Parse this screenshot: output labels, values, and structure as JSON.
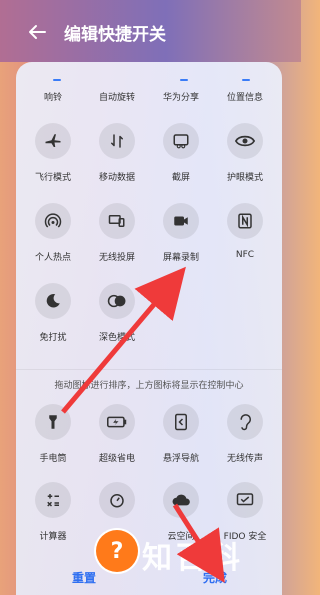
{
  "header": {
    "title": "编辑快捷开关"
  },
  "top_row": [
    "响铃",
    "自动旋转",
    "华为分享",
    "位置信息"
  ],
  "active_tiles": [
    {
      "label": "飞行模式",
      "icon": "airplane-icon"
    },
    {
      "label": "移动数据",
      "icon": "mobile-data-icon"
    },
    {
      "label": "截屏",
      "icon": "screenshot-icon"
    },
    {
      "label": "护眼模式",
      "icon": "eye-icon"
    },
    {
      "label": "个人热点",
      "icon": "hotspot-icon"
    },
    {
      "label": "无线投屏",
      "icon": "wireless-projection-icon"
    },
    {
      "label": "屏幕录制",
      "icon": "screen-record-icon"
    },
    {
      "label": "NFC",
      "icon": "nfc-icon"
    },
    {
      "label": "免打扰",
      "icon": "moon-icon"
    },
    {
      "label": "深色模式",
      "icon": "dark-mode-icon"
    }
  ],
  "hint": "拖动图标进行排序，上方图标将显示在控制中心",
  "inactive_tiles": [
    {
      "label": "手电筒",
      "icon": "flashlight-icon"
    },
    {
      "label": "超级省电",
      "icon": "battery-saver-icon"
    },
    {
      "label": "悬浮导航",
      "icon": "floating-nav-icon"
    },
    {
      "label": "无线传声",
      "icon": "hearing-icon"
    },
    {
      "label": "计算器",
      "icon": "calculator-icon"
    },
    {
      "label": "计时器",
      "icon": "timer-icon"
    },
    {
      "label": "云空间",
      "icon": "cloud-icon"
    },
    {
      "label": "FIDO 安全",
      "icon": "fido-icon"
    }
  ],
  "buttons": {
    "reset": "重置",
    "done": "完成"
  },
  "watermark": {
    "text": "知百科"
  },
  "colors": {
    "accent": "#2f6ff1",
    "arrow": "#ef3a3a"
  }
}
